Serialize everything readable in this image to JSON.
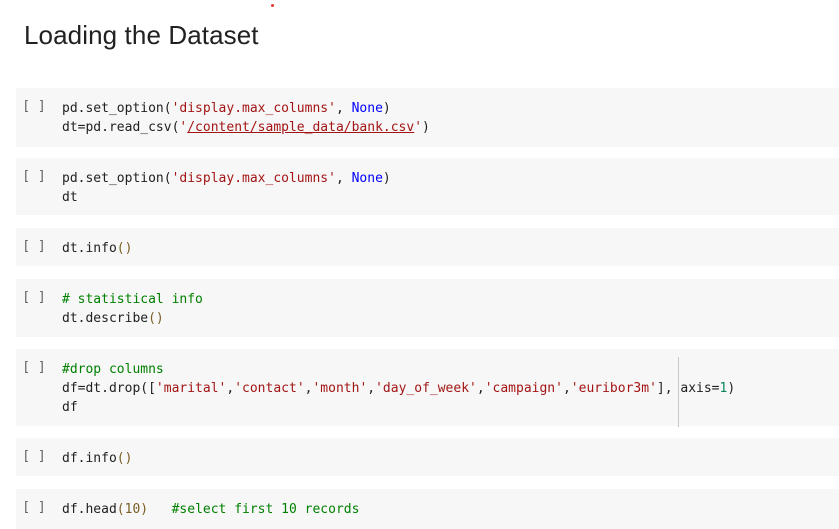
{
  "heading": "Loading the Dataset",
  "run_indicator": "[ ]",
  "cells": [
    {
      "lines": [
        [
          [
            "pd.set_option(",
            ""
          ],
          [
            "'display.max_columns'",
            "str"
          ],
          [
            ", ",
            ""
          ],
          [
            "None",
            "kw"
          ],
          [
            ")",
            ""
          ]
        ],
        [
          [
            "dt=pd.read_csv(",
            ""
          ],
          [
            "'",
            "str"
          ],
          [
            "/content/sample_data/bank.csv",
            "link"
          ],
          [
            "'",
            "str"
          ],
          [
            ")",
            ""
          ]
        ]
      ]
    },
    {
      "lines": [
        [
          [
            "pd.set_option(",
            ""
          ],
          [
            "'display.max_columns'",
            "str"
          ],
          [
            ", ",
            ""
          ],
          [
            "None",
            "kw"
          ],
          [
            ")",
            ""
          ]
        ],
        [
          [
            "dt",
            ""
          ]
        ]
      ]
    },
    {
      "lines": [
        [
          [
            "dt.info",
            ""
          ],
          [
            "()",
            "par"
          ]
        ]
      ]
    },
    {
      "lines": [
        [
          [
            "# statistical info",
            "cm"
          ]
        ],
        [
          [
            "dt.describe",
            ""
          ],
          [
            "()",
            "par"
          ]
        ]
      ]
    },
    {
      "lines": [
        [
          [
            "#drop columns",
            "cm"
          ]
        ],
        [
          [
            "df=dt.drop([",
            ""
          ],
          [
            "'marital'",
            "str"
          ],
          [
            ",",
            ""
          ],
          [
            "'contact'",
            "str"
          ],
          [
            ",",
            ""
          ],
          [
            "'month'",
            "str"
          ],
          [
            ",",
            ""
          ],
          [
            "'day_of_week'",
            "str"
          ],
          [
            ",",
            ""
          ],
          [
            "'campaign'",
            "str"
          ],
          [
            ",",
            ""
          ],
          [
            "'euribor3m'",
            "str"
          ],
          [
            "], axis=",
            ""
          ],
          [
            "1",
            "num"
          ],
          [
            ")",
            ""
          ]
        ],
        [
          [
            "df",
            ""
          ]
        ]
      ]
    },
    {
      "lines": [
        [
          [
            "df.info",
            ""
          ],
          [
            "()",
            "par"
          ]
        ]
      ]
    },
    {
      "lines": [
        [
          [
            "df.head",
            ""
          ],
          [
            "(10)",
            "par"
          ],
          [
            "   ",
            ""
          ],
          [
            "#select first 10 records",
            "cm"
          ]
        ]
      ]
    }
  ]
}
